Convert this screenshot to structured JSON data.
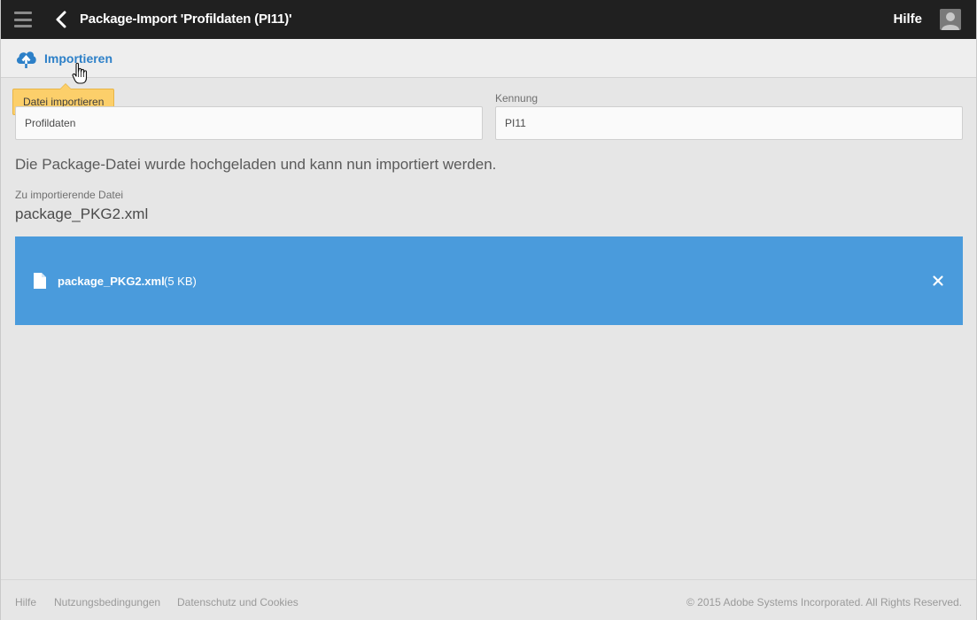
{
  "header": {
    "title": "Package-Import 'Profildaten (PI11)'",
    "help_label": "Hilfe"
  },
  "toolbar": {
    "import_label": "Importieren",
    "tooltip": "Datei importieren"
  },
  "form": {
    "label_field": {
      "label": "",
      "value": "Profildaten"
    },
    "id_field": {
      "label": "Kennung",
      "value": "PI11"
    }
  },
  "status_message": "Die Package-Datei wurde hochgeladen und kann nun importiert werden.",
  "file_section": {
    "label": "Zu importierende Datei",
    "file_name": "package_PKG2.xml"
  },
  "upload_box": {
    "file_name": "package_PKG2.xml",
    "file_size": "(5 KB)",
    "background": "#4a9bdc"
  },
  "footer": {
    "links": [
      "Hilfe",
      "Nutzungsbedingungen",
      "Datenschutz und Cookies"
    ],
    "copyright": "© 2015 Adobe Systems Incorporated. All Rights Reserved."
  },
  "colors": {
    "topbar": "#202020",
    "accent": "#2d80c8",
    "tooltip": "#fccf6a"
  },
  "icons": [
    "hamburger-menu-icon",
    "chevron-left-icon",
    "user-avatar-icon",
    "cloud-upload-icon",
    "hand-cursor-icon",
    "document-icon",
    "close-icon"
  ]
}
